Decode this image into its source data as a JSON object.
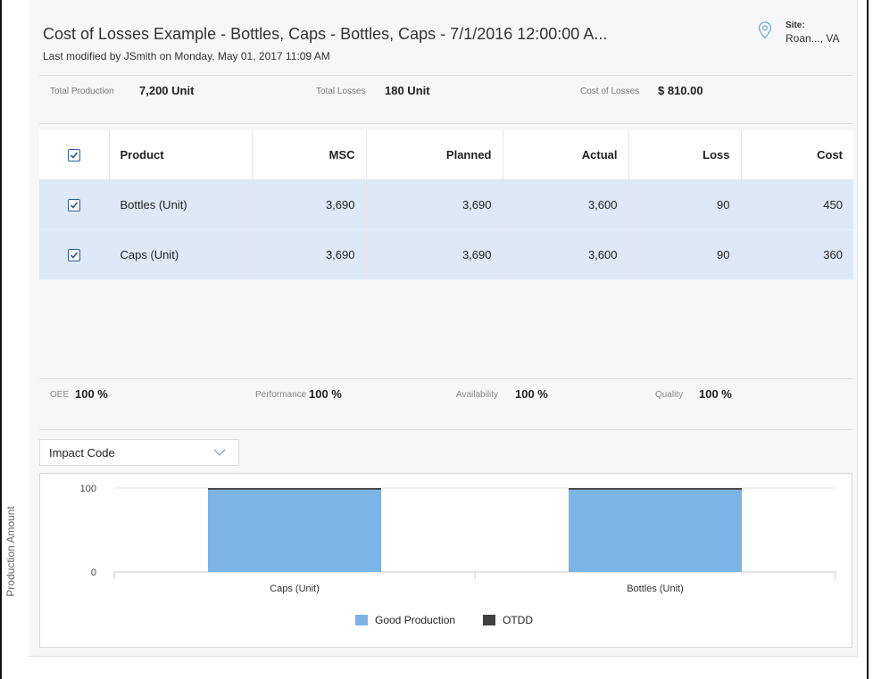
{
  "header": {
    "title": "Cost of Losses Example - Bottles, Caps - Bottles, Caps - 7/1/2016 12:00:00 A...",
    "subtitle": "Last modified by JSmith on Monday, May 01, 2017 11:09 AM",
    "site_label": "Site:",
    "site_value": "Roan..., VA",
    "site_icon": "location-pin-icon"
  },
  "summary": {
    "total_production_label": "Total Production",
    "total_production_value": "7,200 Unit",
    "total_losses_label": "Total Losses",
    "total_losses_value": "180 Unit",
    "cost_of_losses_label": "Cost of Losses",
    "cost_of_losses_value": "$ 810.00"
  },
  "table": {
    "columns": [
      "Product",
      "MSC",
      "Planned",
      "Actual",
      "Loss",
      "Cost"
    ],
    "header_checked": true,
    "rows": [
      {
        "checked": true,
        "product": "Bottles (Unit)",
        "msc": "3,690",
        "planned": "3,690",
        "actual": "3,600",
        "loss": "90",
        "cost": "450"
      },
      {
        "checked": true,
        "product": "Caps (Unit)",
        "msc": "3,690",
        "planned": "3,690",
        "actual": "3,600",
        "loss": "90",
        "cost": "360"
      }
    ]
  },
  "kpis": {
    "oee_label": "OEE",
    "oee_value": "100 %",
    "performance_label": "Performance",
    "performance_value": "100 %",
    "availability_label": "Availability",
    "availability_value": "100 %",
    "quality_label": "Quality",
    "quality_value": "100 %"
  },
  "filter": {
    "selected": "Impact Code",
    "icon": "chevron-down-icon"
  },
  "colors": {
    "good_production": "#7cb4e8",
    "otdd": "#404040",
    "row_highlight": "#dde9f7",
    "checkbox": "#2a5c94"
  },
  "chart_data": {
    "type": "bar",
    "stacked": true,
    "categories": [
      "Caps (Unit)",
      "Bottles (Unit)"
    ],
    "series": [
      {
        "name": "Good Production",
        "values": [
          98,
          98
        ]
      },
      {
        "name": "OTDD",
        "values": [
          2,
          2
        ]
      }
    ],
    "ylabel": "Production Amount",
    "ylim": [
      0,
      100
    ],
    "yticks": [
      "0",
      "100"
    ],
    "legend_position": "bottom",
    "grid": true
  }
}
